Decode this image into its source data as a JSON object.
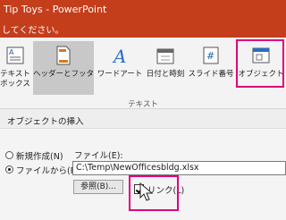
{
  "app": {
    "title": "Tip Toys - PowerPoint",
    "tell_text": "してください。"
  },
  "ribbon": {
    "buttons": [
      {
        "line1": "テキスト",
        "line2": "ボックス"
      },
      {
        "line1": "ヘッダーとフッター",
        "line2": ""
      },
      {
        "line1": "ワードアート",
        "line2": ""
      },
      {
        "line1": "日付と時刻",
        "line2": ""
      },
      {
        "line1": "スライド番号",
        "line2": ""
      },
      {
        "line1": "オブジェクト",
        "line2": ""
      }
    ],
    "group_label": "テキスト"
  },
  "dialog": {
    "title": "オブジェクトの挿入",
    "radio_new": "新規作成(N)",
    "radio_file": "ファイルから(F)",
    "file_label": "ファイル(E):",
    "file_path": "C:\\Temp\\NewOfficesbldg.xlsx",
    "browse_label": "参照(B)...",
    "link_label": "リンク(L)",
    "link_checked": true,
    "selected_source": "file"
  },
  "colors": {
    "title_bar": "#c43e1c",
    "highlight": "#e0007a"
  },
  "icons": [
    "textbox-icon",
    "header-footer-icon",
    "wordart-icon",
    "date-time-icon",
    "slide-number-icon",
    "object-icon",
    "mouse-cursor-icon"
  ]
}
